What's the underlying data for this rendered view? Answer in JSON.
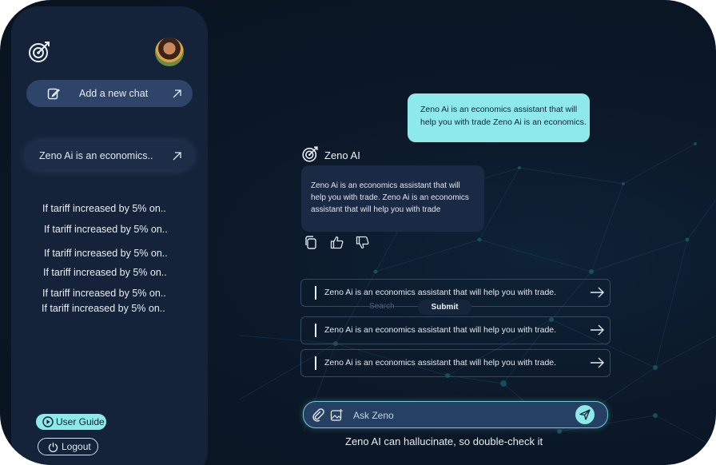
{
  "sidebar": {
    "new_chat_label": "Add a new chat",
    "active_chat": "Zeno Ai is an economics..",
    "history": [
      "If tariff increased by 5% on..",
      "If tariff increased by 5% on..",
      "If tariff increased by 5% on..",
      "If tariff increased by 5% on..",
      "If tariff increased by 5% on..",
      "If tariff increased by 5% on.."
    ],
    "user_guide_label": "User Guide",
    "logout_label": "Logout"
  },
  "chat": {
    "user_message": "Zeno Ai is an economics assistant that will help you with trade Zeno Ai is an economics.",
    "bot_name": "Zeno AI",
    "bot_message": "Zeno Ai is an economics assistant that will help you with trade. Zeno Ai is an economics assistant that will help you with trade",
    "suggestions": [
      "Zeno Ai is an economics assistant that will help you with trade.",
      "Zeno Ai is an economics assistant that will help you with trade.",
      "Zeno Ai is an economics assistant that will help you with trade."
    ],
    "tooltip_submit": "Submit",
    "ghost_text": "Search"
  },
  "composer": {
    "placeholder": "Ask Zeno"
  },
  "disclaimer": "Zeno AI can hallucinate, so double-check it",
  "colors": {
    "accent": "#8ee9ea",
    "sidebar": "#15233a",
    "background": "#0b1828"
  }
}
